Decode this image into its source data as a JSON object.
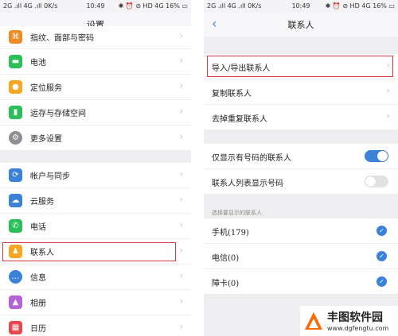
{
  "left": {
    "status": {
      "left": "2G .ıll 4G .ıll 0K/s",
      "time": "10:49",
      "right": "✱ ⏰ ⊘ HD 4G 16% ▭"
    },
    "title": "设置",
    "items": [
      {
        "label": "指纹、面部与密码",
        "icon": "fingerprint-icon",
        "color": "#f08a24"
      },
      {
        "label": "电池",
        "icon": "battery-icon",
        "color": "#2bbf5a"
      },
      {
        "label": "定位服务",
        "icon": "location-icon",
        "color": "#f5a623"
      },
      {
        "label": "运存与存储空间",
        "icon": "storage-icon",
        "color": "#2bbf5a"
      },
      {
        "label": "更多设置",
        "icon": "gear-icon",
        "color": "#8e8e93"
      },
      {
        "label": "帐户与同步",
        "icon": "account-icon",
        "color": "#3b82d8"
      },
      {
        "label": "云服务",
        "icon": "cloud-icon",
        "color": "#3b82d8"
      },
      {
        "label": "电话",
        "icon": "phone-icon",
        "color": "#2bbf5a"
      },
      {
        "label": "联系人",
        "icon": "contacts-icon",
        "color": "#f5a623"
      },
      {
        "label": "信息",
        "icon": "message-icon",
        "color": "#3b82d8"
      },
      {
        "label": "相册",
        "icon": "album-icon",
        "color": "#b462d6"
      },
      {
        "label": "日历",
        "icon": "calendar-icon",
        "color": "#e5484d"
      }
    ]
  },
  "right": {
    "status": {
      "left": "2G .ıll 4G .ıll 0K/s",
      "time": "10:49",
      "right": "✱ ⏰ ⊘ HD 4G 16% ▭"
    },
    "title": "联系人",
    "nav_items": [
      "导入/导出联系人",
      "复制联系人",
      "去掉重复联系人"
    ],
    "toggles": [
      {
        "label": "仅显示有号码的联系人",
        "on": true
      },
      {
        "label": "联系人列表显示号码",
        "on": false
      }
    ],
    "section_label": "选择要显示的联系人",
    "accounts": [
      {
        "label": "手机(179)",
        "checked": true
      },
      {
        "label": "电信(0)",
        "checked": true
      },
      {
        "label": "障卡(0)",
        "checked": true
      }
    ]
  },
  "watermark": {
    "name": "丰图软件园",
    "url": "www.dgfengtu.com"
  }
}
